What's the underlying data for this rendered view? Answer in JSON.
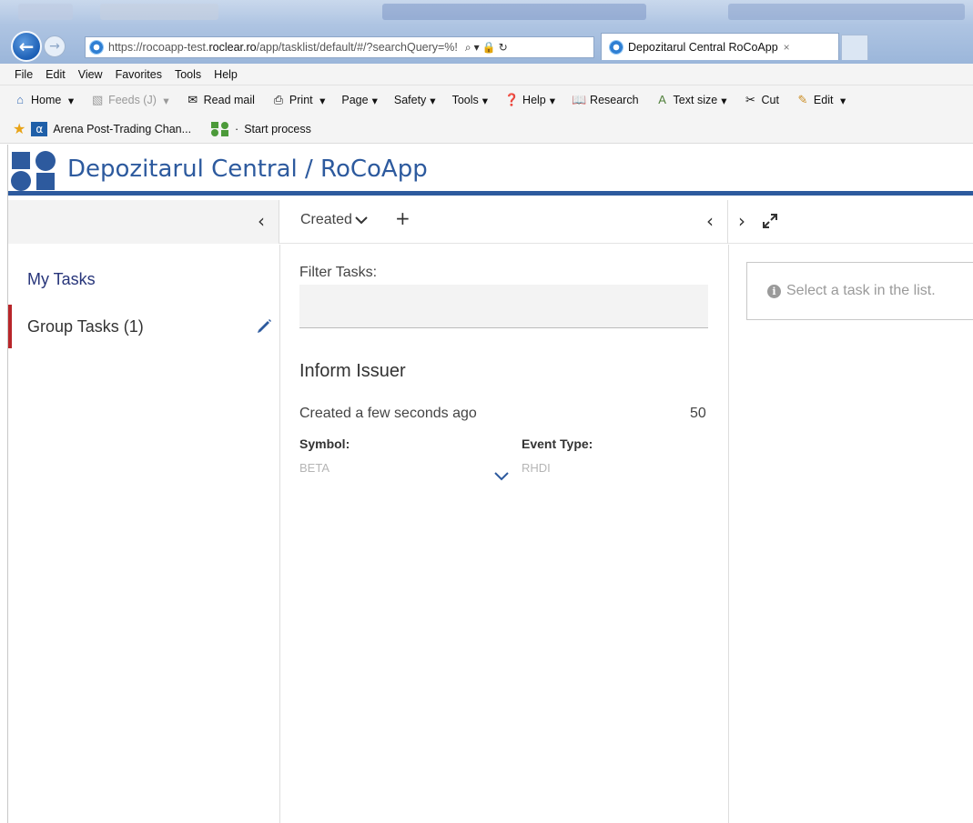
{
  "browser": {
    "url_prefix": "https://rocoapp-test.",
    "url_domain": "roclear.ro",
    "url_path": "/app/tasklist/default/#/?searchQuery=%!",
    "tab_title": "Depozitarul Central RoCoApp",
    "tab_close": "×",
    "menu": [
      "File",
      "Edit",
      "View",
      "Favorites",
      "Tools",
      "Help"
    ],
    "commands": {
      "home": "Home",
      "feeds": "Feeds (J)",
      "read_mail": "Read mail",
      "print": "Print",
      "page": "Page",
      "safety": "Safety",
      "tools": "Tools",
      "help": "Help",
      "research": "Research",
      "text_size": "Text size",
      "cut": "Cut",
      "edit": "Edit"
    },
    "favorites": {
      "arena": "Arena Post-Trading Chan...",
      "start_process": "Start process"
    }
  },
  "app": {
    "title": "Depozitarul Central / RoCoApp",
    "brand_color": "#2d5a9e",
    "sort_label": "Created",
    "nav": {
      "my_tasks": "My Tasks",
      "group_tasks": "Group Tasks (1)",
      "active_marker_color": "#b8262a"
    },
    "filter": {
      "label": "Filter Tasks:",
      "value": ""
    },
    "task": {
      "title": "Inform Issuer",
      "created": "Created a few seconds ago",
      "priority": "50",
      "symbol_label": "Symbol:",
      "symbol_value": "BETA",
      "event_type_label": "Event Type:",
      "event_type_value": "RHDI"
    },
    "detail": {
      "info_icon": "info-circle-icon",
      "empty_message": "Select a task in the list."
    }
  }
}
